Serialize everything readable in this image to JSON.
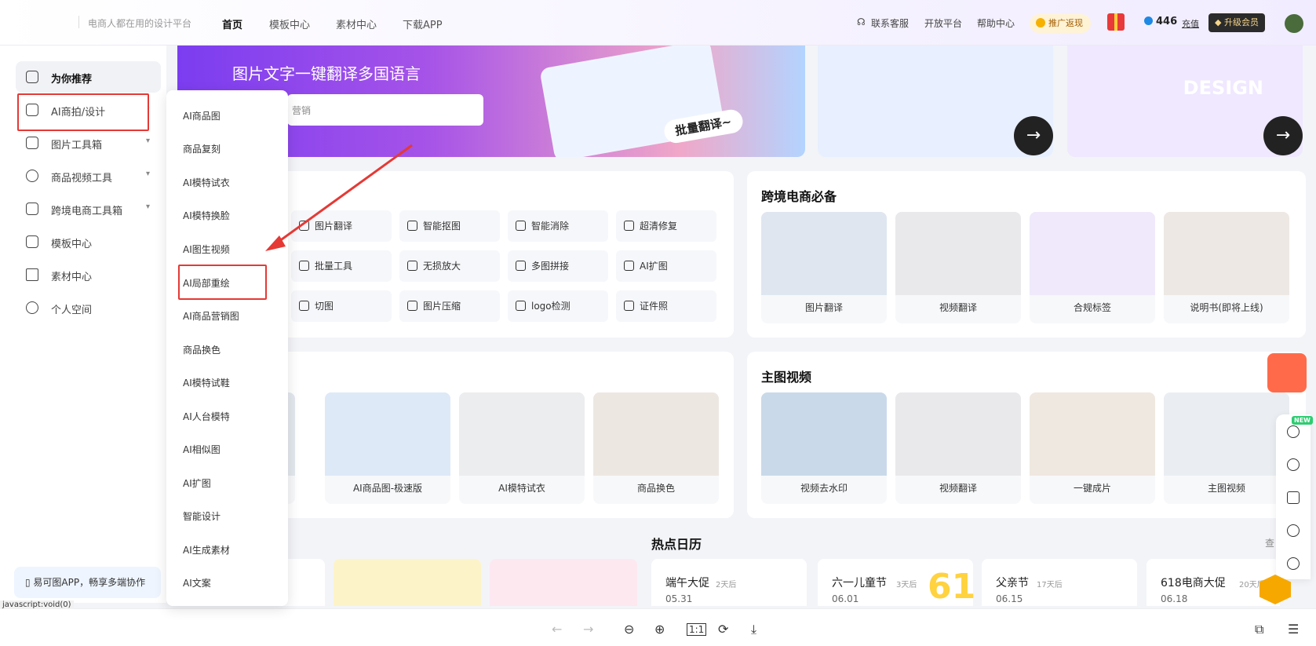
{
  "header": {
    "slogan": "电商人都在用的设计平台",
    "nav": [
      "首页",
      "模板中心",
      "素材中心",
      "下载APP"
    ],
    "links": [
      "联系客服",
      "开放平台",
      "帮助中心"
    ],
    "promo": "推广返现",
    "points": "446",
    "recharge": "充值",
    "vip": "升级会员"
  },
  "sidebar": {
    "items": [
      {
        "label": "为你推荐",
        "icon": "home-icon"
      },
      {
        "label": "AI商拍/设计",
        "icon": "ai-icon"
      },
      {
        "label": "图片工具箱",
        "icon": "toolbox-icon"
      },
      {
        "label": "商品视频工具",
        "icon": "video-icon"
      },
      {
        "label": "跨境电商工具箱",
        "icon": "bookmark-icon"
      },
      {
        "label": "模板中心",
        "icon": "template-icon"
      },
      {
        "label": "素材中心",
        "icon": "material-icon"
      },
      {
        "label": "个人空间",
        "icon": "user-icon"
      }
    ],
    "app_promo": "易可图APP，畅享多端协作"
  },
  "dropdown": {
    "items": [
      "AI商品图",
      "商品复刻",
      "AI模特试衣",
      "AI模特换脸",
      "AI图生视频",
      "AI局部重绘",
      "AI商品营销图",
      "商品换色",
      "AI模特试鞋",
      "AI人台模特",
      "AI相似图",
      "AI扩图",
      "智能设计",
      "AI生成素材",
      "AI文案"
    ]
  },
  "banner": {
    "headline": "图片文字一键翻译多国语言",
    "search_placeholder": "营销",
    "button": "批量翻译~"
  },
  "tools": {
    "row1": [
      "图片翻译",
      "智能抠图",
      "智能消除",
      "超清修复"
    ],
    "row2": [
      "批量工具",
      "无损放大",
      "多图拼接",
      "AI扩图"
    ],
    "row3": [
      "切图",
      "图片压缩",
      "logo检测",
      "证件照"
    ]
  },
  "cross_border": {
    "title": "跨境电商必备",
    "cards": [
      "图片翻译",
      "视频翻译",
      "合规标签",
      "说明书(即将上线)"
    ]
  },
  "ai_cards": [
    "AI商品图-极速版",
    "AI模特试衣",
    "商品换色"
  ],
  "main_video": {
    "title": "主图视频",
    "cards": [
      "视频去水印",
      "视频翻译",
      "一键成片",
      "主图视频"
    ]
  },
  "calendar": {
    "title": "热点日历",
    "more": "查",
    "events": [
      {
        "name": "端午大促",
        "days": "2天后",
        "date": "05.31"
      },
      {
        "name": "六一儿童节",
        "days": "3天后",
        "date": "06.01"
      },
      {
        "name": "父亲节",
        "days": "17天后",
        "date": "06.15"
      },
      {
        "name": "618电商大促",
        "days": "20天后",
        "date": "06.18"
      }
    ]
  },
  "right_rail": {
    "new_tag": "NEW"
  },
  "status_url": "javascript:void(0)"
}
